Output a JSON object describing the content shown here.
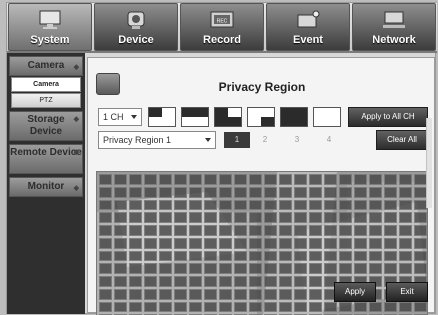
{
  "tabs": [
    {
      "label": "System",
      "icon": "monitor-icon",
      "active": true
    },
    {
      "label": "Device",
      "icon": "camera-icon",
      "active": false
    },
    {
      "label": "Record",
      "icon": "record-icon",
      "active": false
    },
    {
      "label": "Event",
      "icon": "event-icon",
      "active": false
    },
    {
      "label": "Network",
      "icon": "network-icon",
      "active": false
    }
  ],
  "sidebar": {
    "camera": "Camera",
    "camera_sub": "Camera",
    "ptz": "PTZ",
    "storage": "Storage Device",
    "remote": "Remote Device",
    "monitor": "Monitor"
  },
  "main": {
    "title": "Privacy Region",
    "channel": "1 CH",
    "apply_all": "Apply to All CH",
    "region_select": "Privacy Region 1",
    "region_numbers": [
      "1",
      "2",
      "3",
      "4"
    ],
    "active_region": "1",
    "clear_all": "Clear All",
    "apply": "Apply",
    "exit": "Exit"
  },
  "colors": {
    "tab_dark": "#3c3c3c",
    "sidebar": "#2f2f2f",
    "mask_cell": "#464646"
  }
}
